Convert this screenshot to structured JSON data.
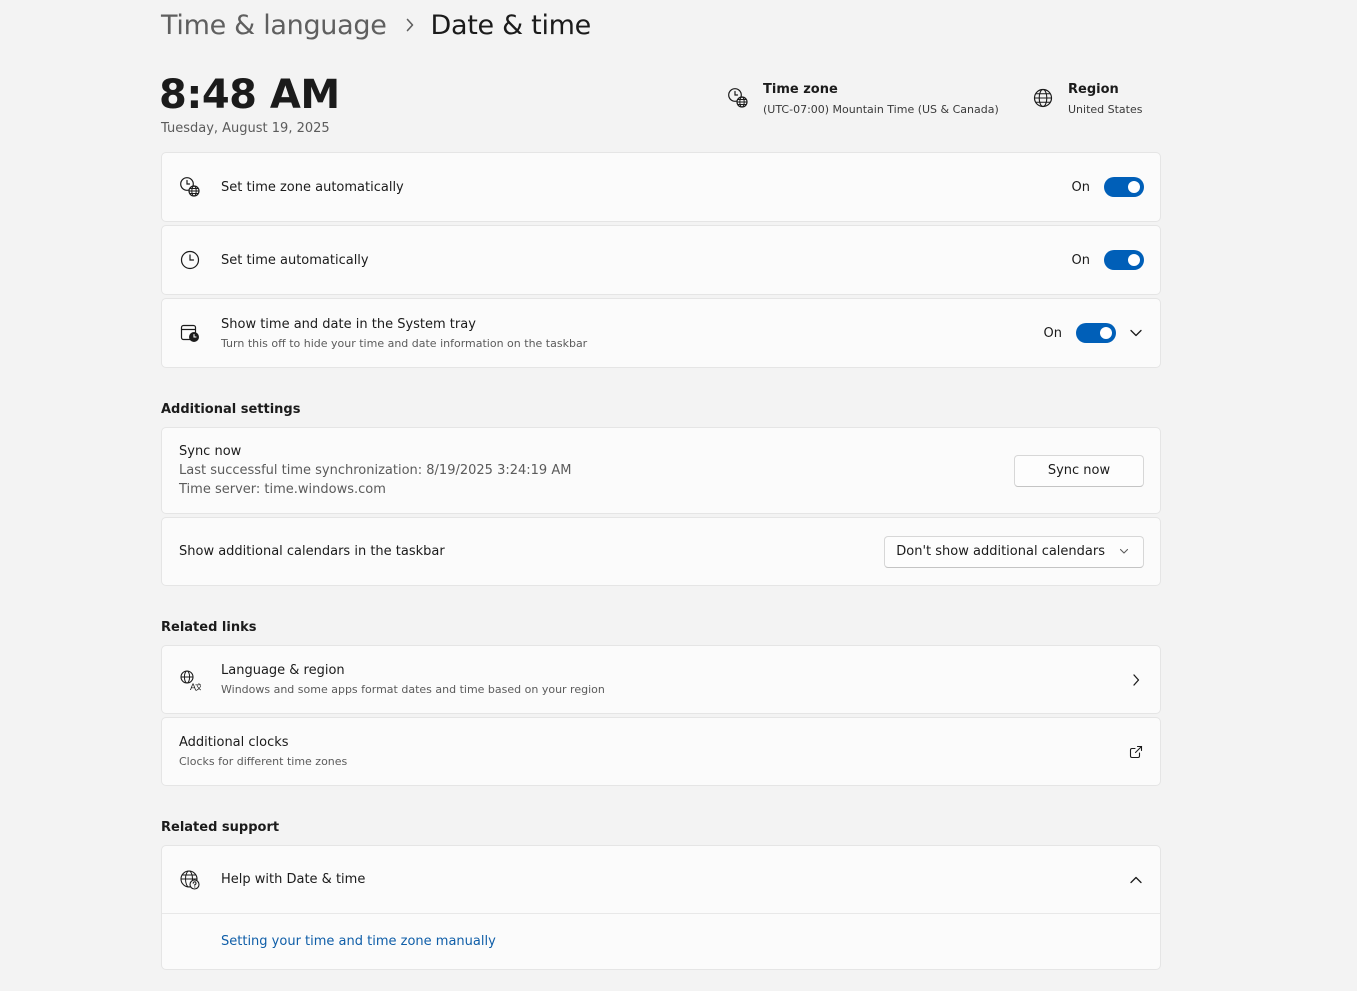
{
  "breadcrumb": {
    "parent": "Time & language",
    "current": "Date & time"
  },
  "clock": {
    "time": "8:48 AM",
    "date": "Tuesday, August 19, 2025"
  },
  "timezone_info": {
    "title": "Time zone",
    "value": "(UTC-07:00) Mountain Time (US & Canada)",
    "icon": "clock-globe-icon"
  },
  "region_info": {
    "title": "Region",
    "value": "United States",
    "icon": "globe-icon"
  },
  "settings": {
    "tz_auto": {
      "label": "Set time zone automatically",
      "state": "On",
      "icon": "clock-globe-icon"
    },
    "time_auto": {
      "label": "Set time automatically",
      "state": "On",
      "icon": "clock-icon"
    },
    "tray": {
      "label": "Show time and date in the System tray",
      "sublabel": "Turn this off to hide your time and date information on the taskbar",
      "state": "On",
      "icon": "calendar-clock-icon"
    }
  },
  "additional": {
    "header": "Additional settings",
    "sync": {
      "title": "Sync now",
      "last": "Last successful time synchronization: 8/19/2025 3:24:19 AM",
      "server": "Time server: time.windows.com",
      "button": "Sync now"
    },
    "calendars": {
      "label": "Show additional calendars in the taskbar",
      "selected": "Don't show additional calendars"
    }
  },
  "related_links": {
    "header": "Related links",
    "language": {
      "title": "Language & region",
      "sub": "Windows and some apps format dates and time based on your region",
      "icon": "language-icon"
    },
    "clocks": {
      "title": "Additional clocks",
      "sub": "Clocks for different time zones",
      "icon": "external-link-icon"
    }
  },
  "related_support": {
    "header": "Related support",
    "help": {
      "title": "Help with Date & time",
      "link": "Setting your time and time zone manually",
      "icon": "help-globe-icon"
    }
  },
  "colors": {
    "accent": "#005fb8",
    "link": "#0f5ea8",
    "background": "#f3f3f3",
    "card": "#fbfbfb"
  }
}
